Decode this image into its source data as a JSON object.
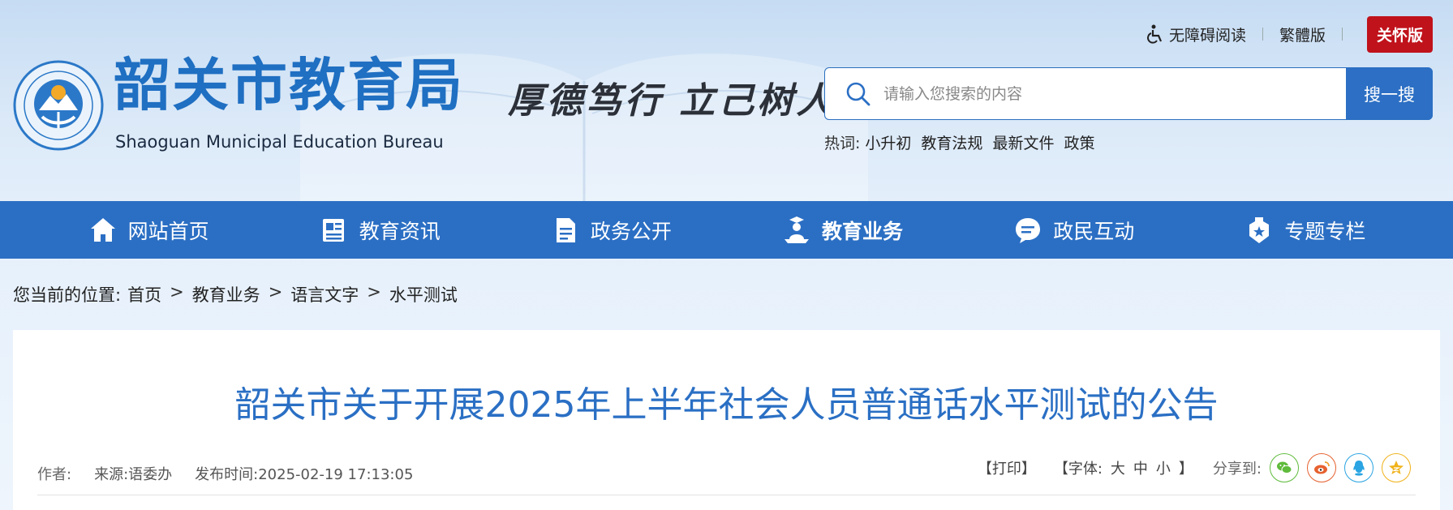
{
  "header": {
    "logo_cn": "韶关市教育局",
    "logo_en": "Shaoguan Municipal Education Bureau",
    "motto": "厚德笃行  立己树人",
    "toplinks": {
      "accessibility": "无障碍阅读",
      "traditional": "繁體版",
      "care": "关怀版"
    },
    "search": {
      "placeholder": "请输入您搜索的内容",
      "button": "搜一搜"
    },
    "hotwords": {
      "label": "热词:",
      "items": [
        "小升初",
        "教育法规",
        "最新文件",
        "政策"
      ]
    }
  },
  "nav": {
    "items": [
      {
        "label": "网站首页",
        "icon": "home-icon"
      },
      {
        "label": "教育资讯",
        "icon": "news-icon"
      },
      {
        "label": "政务公开",
        "icon": "document-icon"
      },
      {
        "label": "教育业务",
        "icon": "education-icon",
        "active": true
      },
      {
        "label": "政民互动",
        "icon": "chat-icon"
      },
      {
        "label": "专题专栏",
        "icon": "badge-icon"
      }
    ]
  },
  "breadcrumb": {
    "prefix": "您当前的位置:",
    "items": [
      "首页",
      "教育业务",
      "语言文字",
      "水平测试"
    ],
    "separator": ">"
  },
  "article": {
    "title": "韶关市关于开展2025年上半年社会人员普通话水平测试的公告",
    "author_label": "作者:",
    "source": "来源:语委办",
    "published": "发布时间:2025-02-19 17:13:05",
    "print": "【打印】",
    "font_label": "【字体:",
    "font_large": "大",
    "font_medium": "中",
    "font_small": "小",
    "font_end": "】",
    "share_label": "分享到:"
  },
  "colors": {
    "brand": "#2b6fc4",
    "care": "#c0121b",
    "wechat": "#5fbb3c",
    "weibo": "#e6612f",
    "qq": "#2aa4e2",
    "qzone": "#f0b21a"
  }
}
